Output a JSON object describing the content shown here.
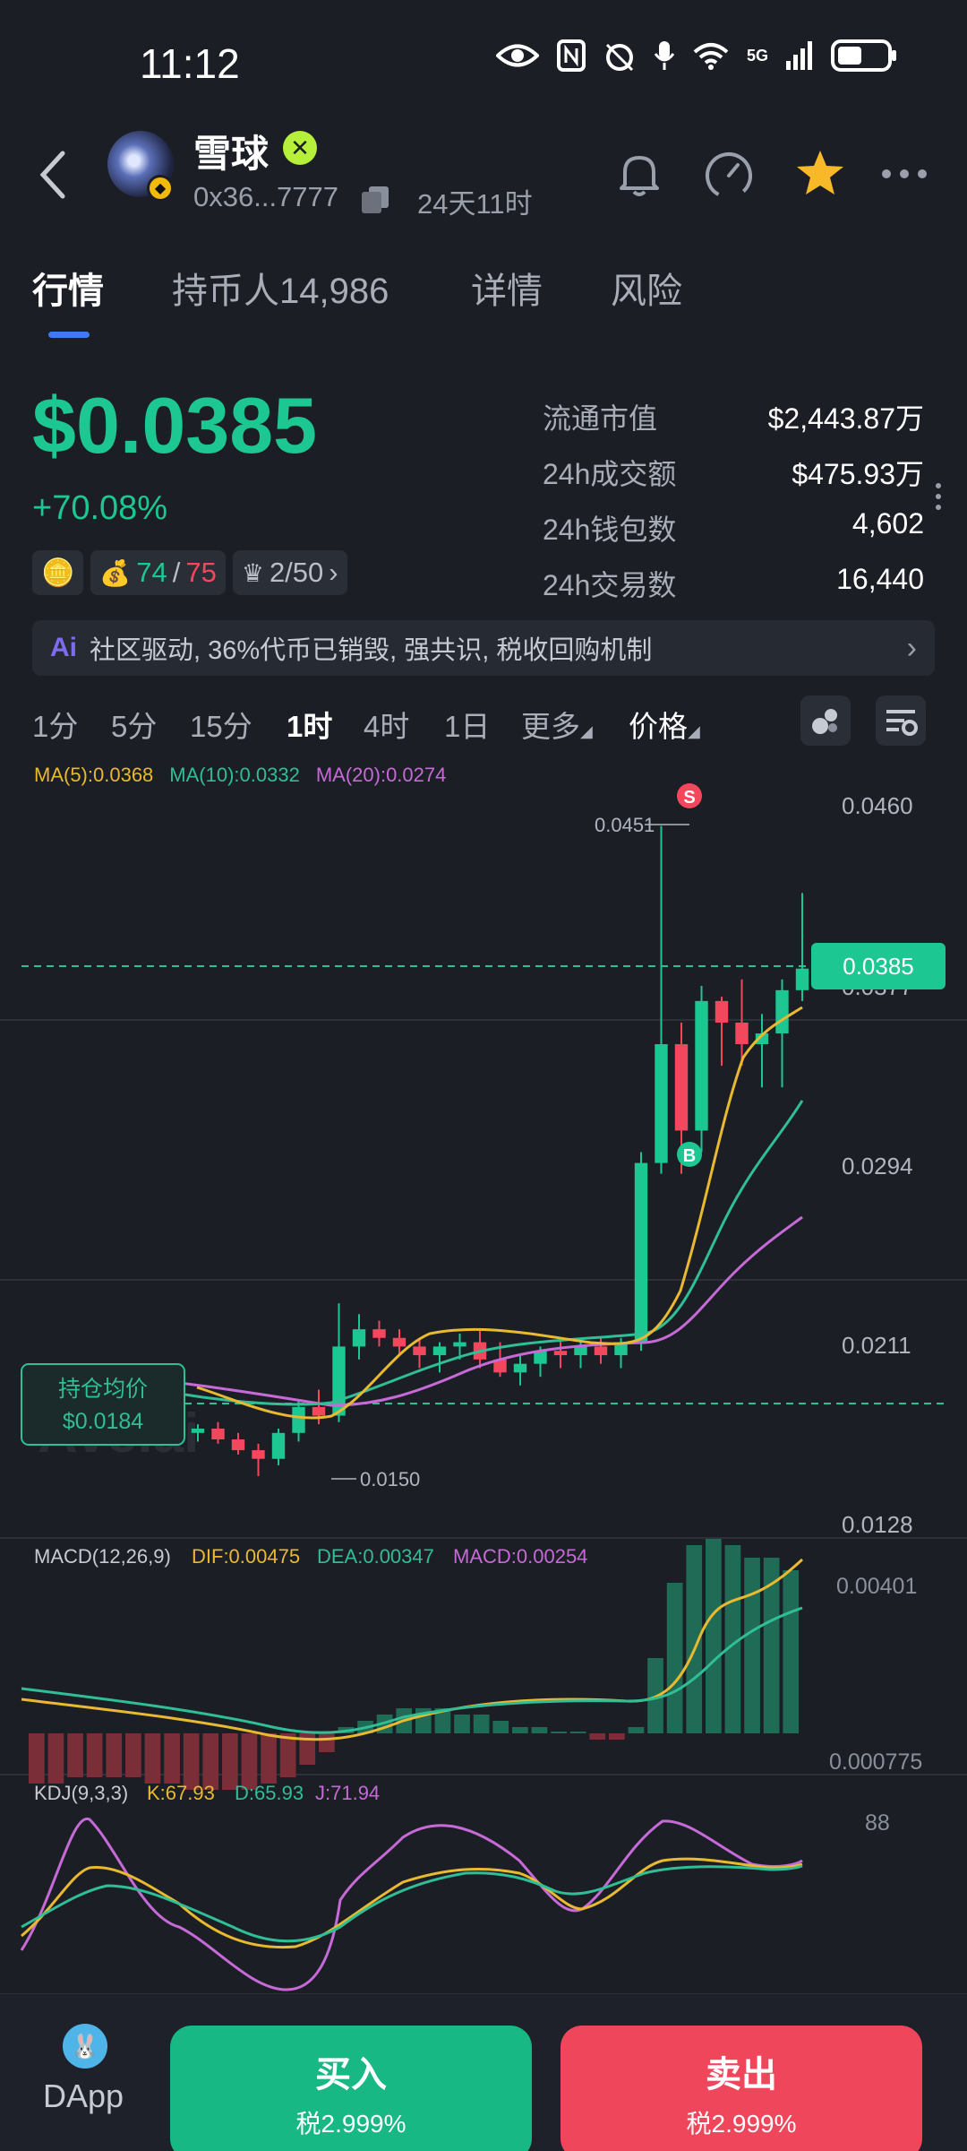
{
  "status_bar": {
    "time": "11:12",
    "network": "5G"
  },
  "header": {
    "token_name": "雪球",
    "address": "0x36...7777",
    "age": "24天11时",
    "icons": [
      "back-icon",
      "bell-icon",
      "speedometer-icon",
      "star-icon",
      "more-icon"
    ]
  },
  "tabs": [
    {
      "label": "行情",
      "active": true
    },
    {
      "label": "持币人14,986"
    },
    {
      "label": "详情"
    },
    {
      "label": "风险"
    }
  ],
  "price": {
    "value": "$0.0385",
    "change": "+70.08%",
    "accent": "#1dc792",
    "down": "#f3475d"
  },
  "badges": {
    "holders_a": "74",
    "holders_sep": "/",
    "holders_b": "75",
    "rank": "2/50"
  },
  "stats": [
    {
      "label": "流通市值",
      "value": "$2,443.87万"
    },
    {
      "label": "24h成交额",
      "value": "$475.93万"
    },
    {
      "label": "24h钱包数",
      "value": "4,602"
    },
    {
      "label": "24h交易数",
      "value": "16,440"
    }
  ],
  "ai_bar": {
    "icon": "Ai",
    "text": "社区驱动, 36%代币已销毁, 强共识, 税收回购机制"
  },
  "intervals": [
    {
      "label": "1分"
    },
    {
      "label": "5分"
    },
    {
      "label": "15分"
    },
    {
      "label": "1时",
      "active": true
    },
    {
      "label": "4时"
    },
    {
      "label": "1日"
    },
    {
      "label": "更多"
    },
    {
      "label": "价格"
    }
  ],
  "chart": {
    "ma": {
      "ma5": "MA(5):0.0368",
      "ma10": "MA(10):0.0332",
      "ma20": "MA(20):0.0274"
    },
    "price_axis": [
      "0.0460",
      "0.0377",
      "0.0294",
      "0.0211",
      "0.0128"
    ],
    "current_price_tag": "0.0385",
    "high_label": "0.0451",
    "low_label": "0.0150",
    "avg_cost_label": "持仓均价",
    "avg_cost_value": "$0.0184",
    "markers": {
      "sell": "S",
      "buy": "B"
    },
    "watermark": "Ave.ai",
    "macd": {
      "title": "MACD(12,26,9)",
      "dif": "DIF:0.00475",
      "dea": "DEA:0.00347",
      "macd": "MACD:0.00254",
      "axis_top": "0.00401",
      "axis_bottom": "0.000775"
    },
    "kdj": {
      "title": "KDJ(9,3,3)",
      "k": "K:67.93",
      "d": "D:65.93",
      "j": "J:71.94",
      "axis_top": "88"
    }
  },
  "chart_data": {
    "type": "candlestick",
    "series": [
      {
        "name": "MA(5)",
        "last": 0.0368
      },
      {
        "name": "MA(10)",
        "last": 0.0332
      },
      {
        "name": "MA(20)",
        "last": 0.0274
      }
    ],
    "ohlc": [
      [
        0.0186,
        0.019,
        0.0183,
        0.0189
      ],
      [
        0.0189,
        0.0191,
        0.0184,
        0.0185
      ],
      [
        0.0185,
        0.0187,
        0.018,
        0.0182
      ],
      [
        0.0182,
        0.0184,
        0.0176,
        0.0178
      ],
      [
        0.0178,
        0.0181,
        0.0172,
        0.0174
      ],
      [
        0.0174,
        0.0176,
        0.0168,
        0.017
      ],
      [
        0.017,
        0.0174,
        0.0166,
        0.0172
      ],
      [
        0.0172,
        0.0175,
        0.0165,
        0.0167
      ],
      [
        0.0167,
        0.017,
        0.016,
        0.0162
      ],
      [
        0.0162,
        0.0165,
        0.015,
        0.0158
      ],
      [
        0.0158,
        0.0172,
        0.0155,
        0.017
      ],
      [
        0.017,
        0.0185,
        0.0166,
        0.0182
      ],
      [
        0.0182,
        0.019,
        0.0174,
        0.0178
      ],
      [
        0.0178,
        0.023,
        0.0175,
        0.021
      ],
      [
        0.021,
        0.0225,
        0.0204,
        0.0218
      ],
      [
        0.0218,
        0.0222,
        0.021,
        0.0214
      ],
      [
        0.0214,
        0.0218,
        0.0206,
        0.021
      ],
      [
        0.021,
        0.0214,
        0.02,
        0.0206
      ],
      [
        0.0206,
        0.0212,
        0.0198,
        0.021
      ],
      [
        0.021,
        0.0216,
        0.0204,
        0.0212
      ],
      [
        0.0212,
        0.0218,
        0.02,
        0.0204
      ],
      [
        0.0204,
        0.0212,
        0.0196,
        0.0198
      ],
      [
        0.0198,
        0.0206,
        0.0192,
        0.0202
      ],
      [
        0.0202,
        0.021,
        0.0196,
        0.0208
      ],
      [
        0.0208,
        0.0214,
        0.02,
        0.0206
      ],
      [
        0.0206,
        0.0212,
        0.02,
        0.021
      ],
      [
        0.021,
        0.0214,
        0.0202,
        0.0206
      ],
      [
        0.0206,
        0.0214,
        0.02,
        0.0212
      ],
      [
        0.0212,
        0.03,
        0.0208,
        0.0295
      ],
      [
        0.0295,
        0.0451,
        0.029,
        0.035
      ],
      [
        0.035,
        0.036,
        0.029,
        0.031
      ],
      [
        0.031,
        0.0377,
        0.03,
        0.037
      ],
      [
        0.037,
        0.0372,
        0.034,
        0.036
      ],
      [
        0.036,
        0.038,
        0.034,
        0.035
      ],
      [
        0.035,
        0.0364,
        0.033,
        0.0355
      ],
      [
        0.0355,
        0.038,
        0.033,
        0.0375
      ],
      [
        0.0375,
        0.042,
        0.037,
        0.0385
      ]
    ],
    "ylim": [
      0.0128,
      0.046
    ],
    "macd_hist": [
      -0.0008,
      -0.0008,
      -0.0007,
      -0.0007,
      -0.0007,
      -0.0007,
      -0.0008,
      -0.0008,
      -0.0009,
      -0.0009,
      -0.0009,
      -0.0009,
      -0.0008,
      -0.0007,
      -0.0005,
      -0.0003,
      0.0001,
      0.0002,
      0.0003,
      0.0004,
      0.0004,
      0.0004,
      0.0003,
      0.0003,
      0.0002,
      0.0001,
      0.0001,
      0.0,
      0.0,
      -0.0001,
      -0.0001,
      0.0001,
      0.0012,
      0.0024,
      0.003,
      0.0031,
      0.003,
      0.0028,
      0.0028,
      0.0026
    ],
    "macd_ylim": [
      0.000775,
      0.00401
    ]
  }
}
